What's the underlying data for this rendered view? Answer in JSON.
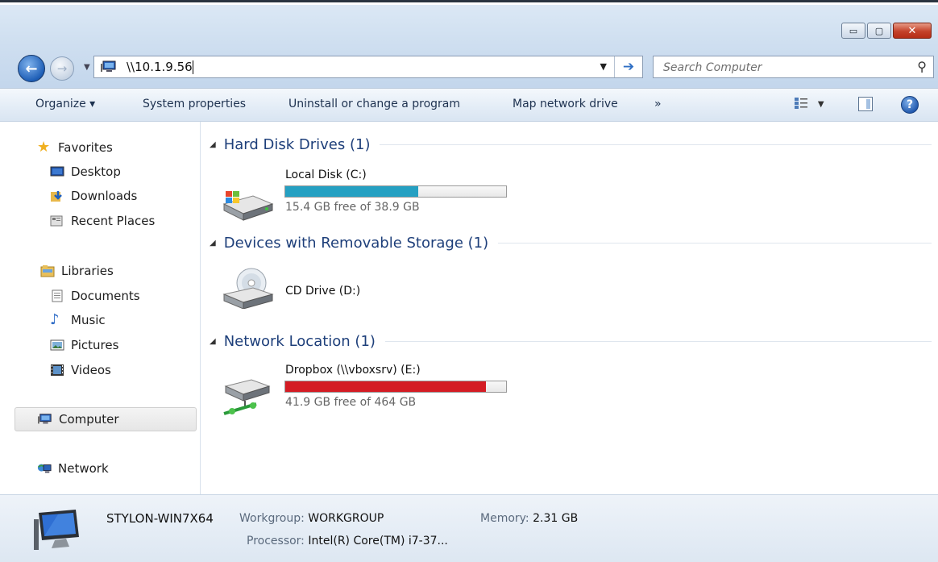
{
  "window": {
    "minimize_glyph": "▭",
    "maximize_glyph": "▢",
    "close_glyph": "✕"
  },
  "address": {
    "path": "\\\\10.1.9.56",
    "search_placeholder": "Search Computer"
  },
  "commands": {
    "organize": "Organize ▾",
    "system_properties": "System properties",
    "uninstall": "Uninstall or change a program",
    "map_drive": "Map network drive",
    "more": "»"
  },
  "nav": {
    "favorites": "Favorites",
    "desktop": "Desktop",
    "downloads": "Downloads",
    "recent_places": "Recent Places",
    "libraries": "Libraries",
    "documents": "Documents",
    "music": "Music",
    "pictures": "Pictures",
    "videos": "Videos",
    "computer": "Computer",
    "network": "Network"
  },
  "groups": {
    "hard_disk": "Hard Disk Drives (1)",
    "removable": "Devices with Removable Storage (1)",
    "network": "Network Location (1)"
  },
  "drives": {
    "c": {
      "name": "Local Disk (C:)",
      "free_text": "15.4 GB free of 38.9 GB",
      "used_fraction": 0.604,
      "bar_color": "#25a0c2"
    },
    "d": {
      "name": "CD Drive (D:)"
    },
    "e": {
      "name": "Dropbox (\\\\vboxsrv) (E:)",
      "free_text": "41.9 GB free of 464 GB",
      "used_fraction": 0.91,
      "bar_color": "#d41c24"
    }
  },
  "details": {
    "computer_name": "STYLON-WIN7X64",
    "workgroup_label": "Workgroup:",
    "workgroup_value": "WORKGROUP",
    "memory_label": "Memory:",
    "memory_value": "2.31 GB",
    "processor_label": "Processor:",
    "processor_value": "Intel(R) Core(TM) i7-37..."
  }
}
